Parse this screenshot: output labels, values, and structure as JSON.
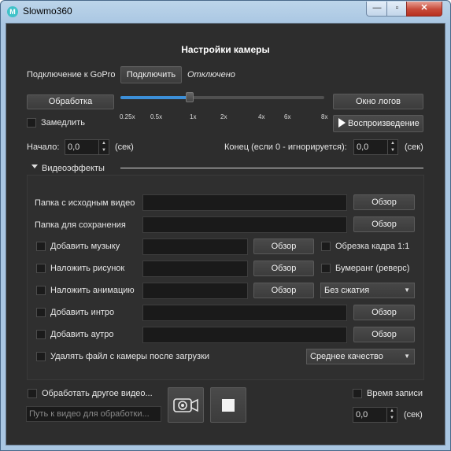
{
  "window": {
    "title": "Slowmo360",
    "icon_letter": "M",
    "controls": {
      "minimize": "—",
      "maximize": "▫",
      "close": "✕"
    }
  },
  "header": {
    "title": "Настройки камеры"
  },
  "connection": {
    "label": "Подключение к GoPro",
    "connect_button": "Подключить",
    "status": "Отключено"
  },
  "processing": {
    "process_button": "Обработка",
    "slowdown_label": "Замедлить",
    "slowdown_checked": false,
    "log_button": "Окно логов",
    "play_button": "Воспроизведение",
    "speed_slider": {
      "ticks": [
        "0.25x",
        "0.5x",
        "1x",
        "2x",
        "4x",
        "6x",
        "8x"
      ],
      "selected": "1x"
    }
  },
  "range": {
    "start_label": "Начало:",
    "start_value": "0,0",
    "start_unit": "(сек)",
    "end_label": "Конец (если 0 - игнорируется):",
    "end_value": "0,0",
    "end_unit": "(сек)"
  },
  "effects": {
    "section_title": "Видеоэффекты",
    "source_folder_label": "Папка с исходным видео",
    "save_folder_label": "Папка для сохранения",
    "browse": "Обзор",
    "add_music": "Добавить музыку",
    "crop_label": "Обрезка кадра 1:1",
    "overlay_image": "Наложить рисунок",
    "boomerang_label": "Бумеранг (реверс)",
    "overlay_animation": "Наложить анимацию",
    "compression_selected": "Без сжатия",
    "add_intro": "Добавить интро",
    "add_outro": "Добавить аутро",
    "delete_after": "Удалять файл с камеры после загрузки",
    "quality_selected": "Среднее качество"
  },
  "footer": {
    "process_other_label": "Обработать другое видео...",
    "path_placeholder": "Путь к видео для обработки...",
    "record_time_label": "Время записи",
    "record_time_value": "0,0",
    "record_time_unit": "(сек)"
  }
}
